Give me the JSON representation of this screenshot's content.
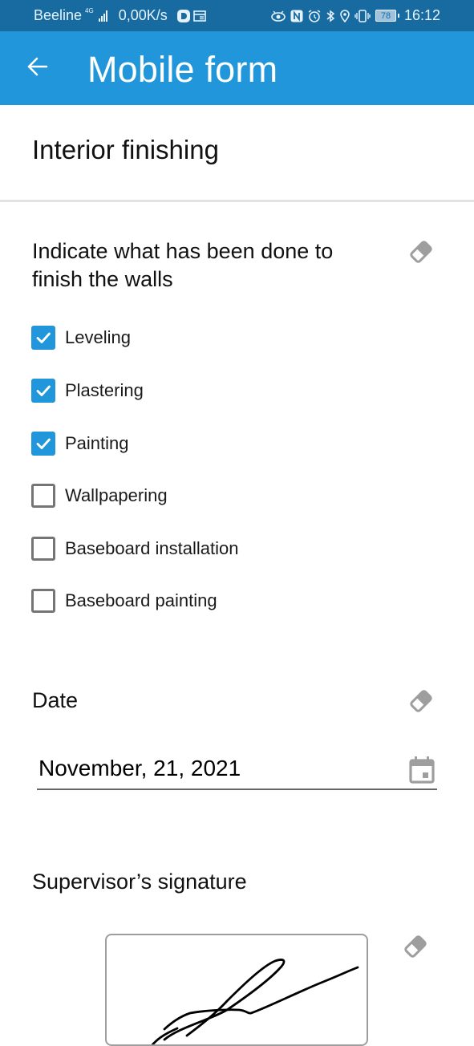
{
  "status_bar": {
    "carrier": "Beeline",
    "network_type": "4G",
    "data_speed": "0,00K/s",
    "battery_level": "78",
    "time": "16:12",
    "icons": [
      "signal-icon",
      "d-app-icon",
      "news-icon",
      "eye-comfort-icon",
      "nfc-icon",
      "alarm-icon",
      "bluetooth-icon",
      "location-icon",
      "vibrate-icon",
      "battery-icon"
    ]
  },
  "app_bar": {
    "title": "Mobile form",
    "back_icon": "arrow-left-icon",
    "background_color": "#2196db"
  },
  "form": {
    "section_title": "Interior finishing",
    "question": {
      "label": "Indicate what has been done to finish the walls",
      "clear_icon": "eraser-icon",
      "options": [
        {
          "label": "Leveling",
          "checked": true
        },
        {
          "label": "Plastering",
          "checked": true
        },
        {
          "label": "Painting",
          "checked": true
        },
        {
          "label": "Wallpapering",
          "checked": false
        },
        {
          "label": "Baseboard installation",
          "checked": false
        },
        {
          "label": "Baseboard painting",
          "checked": false
        }
      ]
    },
    "date": {
      "label": "Date",
      "value": "November, 21, 2021",
      "clear_icon": "eraser-icon",
      "picker_icon": "calendar-icon"
    },
    "signature": {
      "label": "Supervisor’s signature",
      "clear_icon": "eraser-icon",
      "signed": true
    }
  },
  "colors": {
    "accent": "#2196db",
    "status_bar": "#176ba0",
    "checkbox_unchecked": "#757575",
    "icon_gray": "#9e9e9e"
  }
}
